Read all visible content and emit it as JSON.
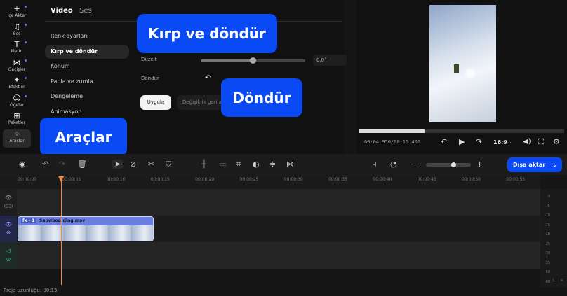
{
  "sidebar": {
    "items": [
      {
        "label": "İçe Aktar",
        "icon": "plus-icon",
        "glyph": "+"
      },
      {
        "label": "Ses",
        "icon": "music-icon",
        "glyph": "♫"
      },
      {
        "label": "Metin",
        "icon": "text-icon",
        "glyph": "T"
      },
      {
        "label": "Geçişler",
        "icon": "transition-icon",
        "glyph": "⋈"
      },
      {
        "label": "Efektler",
        "icon": "sparkle-icon",
        "glyph": "✦"
      },
      {
        "label": "Öğeler",
        "icon": "smiley-icon",
        "glyph": "☺"
      },
      {
        "label": "Paketler",
        "icon": "package-icon",
        "glyph": "⊞"
      },
      {
        "label": "Araçlar",
        "icon": "tools-icon",
        "glyph": "⁘"
      }
    ]
  },
  "panel": {
    "tabs": [
      "Video",
      "Ses"
    ],
    "menu": [
      "Renk ayarları",
      "Kırp ve döndür",
      "Konum",
      "Panla ve zumla",
      "Dengeleme",
      "Animasyon"
    ],
    "straighten_label": "Düzelt",
    "straighten_value": "0,0°",
    "straighten_fraction": 0.5,
    "rotate_label": "Döndür",
    "apply": "Uygula",
    "undo_changes": "Değişiklik geri al"
  },
  "callouts": {
    "crop": "Kırp ve döndür",
    "rotate": "Döndür",
    "tools": "Araçlar"
  },
  "preview": {
    "time": "00:04.950/00:15.400",
    "progress": 0.32,
    "aspect": "16:9"
  },
  "toolbar": {
    "export": "Dışa aktar",
    "zoom_fraction": 0.6
  },
  "ruler": [
    "00:00:00",
    "00:00:05",
    "00:00:10",
    "00:00:15",
    "00:00:20",
    "00:00:25",
    "00:00:30",
    "00:00:35",
    "00:00:40",
    "00:00:45",
    "00:00:50",
    "00:00:55"
  ],
  "clip": {
    "badge": "fx - 1",
    "name": "Snowboarding.mov"
  },
  "meter": [
    "0",
    "-5",
    "-10",
    "-15",
    "-20",
    "-25",
    "-30",
    "-35",
    "-50",
    "-60"
  ],
  "meter_channels": [
    "L",
    "R"
  ],
  "status": "Proje uzunluğu: 00:15",
  "colors": {
    "accent": "#0a4af5",
    "playhead": "#f08a3c",
    "clip": "#6a7de0"
  }
}
